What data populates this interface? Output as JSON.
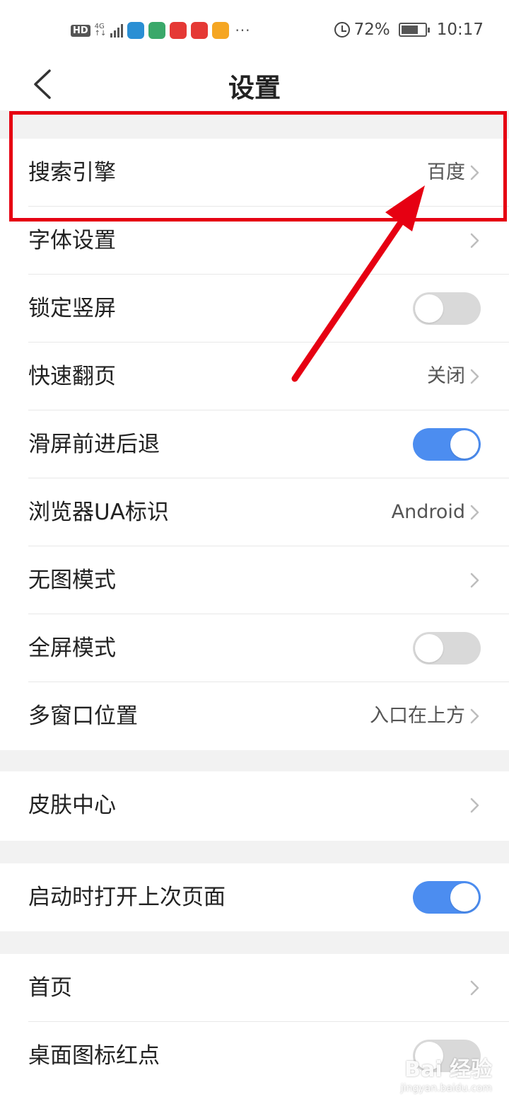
{
  "status_bar": {
    "hd": "HD",
    "network": "4G",
    "network_sub": "↑↓",
    "battery_percent": "72%",
    "battery_level": 0.72,
    "time": "10:17",
    "more": "···",
    "app_icon_colors": [
      "#2a8fd4",
      "#3aa86a",
      "#e53935",
      "#e53935",
      "#f5a623"
    ]
  },
  "header": {
    "title": "设置",
    "back_icon": "chevron-left-icon"
  },
  "settings": [
    {
      "label": "搜索引擎",
      "value": "百度",
      "control": "chevron"
    },
    {
      "label": "字体设置",
      "value": "",
      "control": "chevron"
    },
    {
      "label": "锁定竖屏",
      "control": "toggle",
      "on": false
    },
    {
      "label": "快速翻页",
      "value": "关闭",
      "control": "chevron"
    },
    {
      "label": "滑屏前进后退",
      "control": "toggle",
      "on": true
    },
    {
      "label": "浏览器UA标识",
      "value": "Android",
      "control": "chevron"
    },
    {
      "label": "无图模式",
      "value": "",
      "control": "chevron"
    },
    {
      "label": "全屏模式",
      "control": "toggle",
      "on": false
    },
    {
      "label": "多窗口位置",
      "value": "入口在上方",
      "control": "chevron"
    },
    {
      "label": "皮肤中心",
      "value": "",
      "control": "chevron"
    },
    {
      "label": "启动时打开上次页面",
      "control": "toggle",
      "on": true
    },
    {
      "label": "首页",
      "value": "",
      "control": "chevron"
    },
    {
      "label": "桌面图标红点",
      "control": "toggle",
      "on": false
    }
  ],
  "watermark": {
    "main": "Bai 经验",
    "sub": "jingyan.baidu.com"
  },
  "colors": {
    "accent_blue": "#4c8df0",
    "annotation_red": "#e60012",
    "section_gap": "#f2f2f2"
  }
}
